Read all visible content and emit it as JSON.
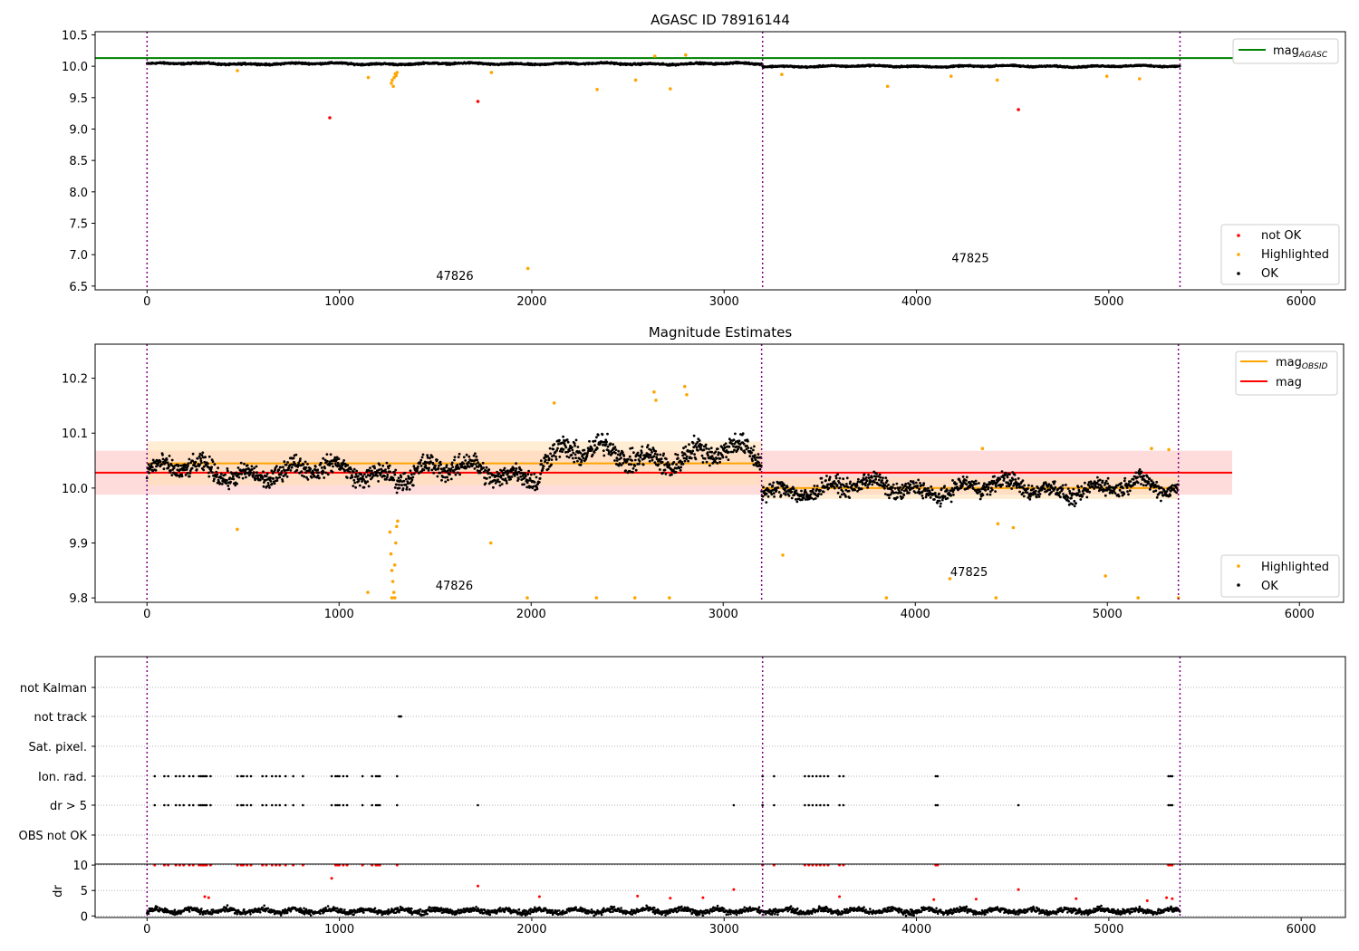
{
  "chart_data": [
    {
      "type": "scatter",
      "title": "AGASC ID 78916144",
      "xlabel": "",
      "ylabel": "",
      "xlim": [
        -270,
        6230
      ],
      "ylim": [
        6.44,
        10.55
      ],
      "x_ticks": [
        0,
        1000,
        2000,
        3000,
        4000,
        5000,
        6000
      ],
      "y_ticks": [
        6.5,
        7.0,
        7.5,
        8.0,
        8.5,
        9.0,
        9.5,
        10.0,
        10.5
      ],
      "obs_boundaries": [
        0,
        3200,
        5370
      ],
      "obs_labels": [
        {
          "text": "47826",
          "x": 1600,
          "y": 6.6
        },
        {
          "text": "47825",
          "x": 4280,
          "y": 6.88
        }
      ],
      "reference_lines": [
        {
          "name": "mag",
          "name_sub": "AGASC",
          "value": 10.13,
          "x_range": [
            -270,
            5650
          ],
          "color": "#008000"
        }
      ],
      "baseline_segments": [
        {
          "x_start": 0,
          "x_end": 3200,
          "level": 10.04,
          "amplitude": 0.035
        },
        {
          "x_start": 3200,
          "x_end": 5370,
          "level": 10.0,
          "amplitude": 0.03
        }
      ],
      "series": [
        {
          "name": "not OK",
          "color": "#ff0000",
          "points": [
            [
              950,
              9.18
            ],
            [
              1720,
              9.44
            ],
            [
              4530,
              9.31
            ]
          ]
        },
        {
          "name": "Highlighted",
          "color": "#ffa500",
          "points": [
            [
              470,
              9.93
            ],
            [
              1150,
              9.82
            ],
            [
              1270,
              9.73
            ],
            [
              1275,
              9.78
            ],
            [
              1280,
              9.68
            ],
            [
              1285,
              9.82
            ],
            [
              1290,
              9.88
            ],
            [
              1295,
              9.85
            ],
            [
              1300,
              9.9
            ],
            [
              1790,
              9.9
            ],
            [
              1980,
              6.78
            ],
            [
              2340,
              9.63
            ],
            [
              2540,
              9.78
            ],
            [
              2720,
              9.64
            ],
            [
              2640,
              10.16
            ],
            [
              2800,
              10.18
            ],
            [
              3300,
              9.87
            ],
            [
              3850,
              9.68
            ],
            [
              4180,
              9.84
            ],
            [
              4420,
              9.78
            ],
            [
              4990,
              9.84
            ],
            [
              5160,
              9.8
            ]
          ]
        },
        {
          "name": "OK",
          "color": "#000000",
          "points": []
        }
      ],
      "legends": [
        {
          "position": "top-right",
          "entries": [
            {
              "name": "mag",
              "sub": "AGASC",
              "kind": "line",
              "color": "#008000"
            }
          ]
        },
        {
          "position": "bottom-right",
          "entries": [
            {
              "name": "not OK",
              "kind": "dot",
              "color": "#ff0000"
            },
            {
              "name": "Highlighted",
              "kind": "dot",
              "color": "#ffa500"
            },
            {
              "name": "OK",
              "kind": "dot",
              "color": "#000000"
            }
          ]
        }
      ]
    },
    {
      "type": "scatter",
      "title": "Magnitude Estimates",
      "xlabel": "",
      "ylabel": "",
      "xlim": [
        -270,
        6230
      ],
      "ylim": [
        9.792,
        10.262
      ],
      "x_ticks": [
        0,
        1000,
        2000,
        3000,
        4000,
        5000,
        6000
      ],
      "y_ticks": [
        9.8,
        9.9,
        10.0,
        10.1,
        10.2
      ],
      "obs_boundaries": [
        0,
        3200,
        5370
      ],
      "obs_labels": [
        {
          "text": "47826",
          "x": 1600,
          "y": 9.815
        },
        {
          "text": "47825",
          "x": 4280,
          "y": 9.84
        }
      ],
      "bands": [
        {
          "name": "mag",
          "center": 10.028,
          "half_width": 0.04,
          "x_range": [
            -270,
            5650
          ],
          "color": "#ffc0c0"
        },
        {
          "name": "mag OBSID 47826",
          "center": 10.045,
          "half_width": 0.04,
          "x_range": [
            0,
            3200
          ],
          "color": "#ffe0b0"
        },
        {
          "name": "mag OBSID 47825",
          "center": 10.0,
          "half_width": 0.02,
          "x_range": [
            3200,
            5370
          ],
          "color": "#ffe0b0"
        }
      ],
      "reference_lines": [
        {
          "name": "mag",
          "value": 10.028,
          "x_range": [
            -270,
            5650
          ],
          "color": "#ff0000"
        },
        {
          "name": "mag",
          "name_sub": "OBSID",
          "value": 10.045,
          "x_range": [
            0,
            3200
          ],
          "color": "#ffa500"
        },
        {
          "name": "mag",
          "name_sub": "OBSID",
          "value": 10.0,
          "x_range": [
            3200,
            5370
          ],
          "color": "#ffa500"
        }
      ],
      "baseline_segments": [
        {
          "x_start": 0,
          "x_end": 1200,
          "level": 10.03,
          "amplitude": 0.045
        },
        {
          "x_start": 1200,
          "x_end": 2050,
          "level": 10.03,
          "amplitude": 0.05
        },
        {
          "x_start": 2050,
          "x_end": 3200,
          "level": 10.06,
          "amplitude": 0.055
        },
        {
          "x_start": 3200,
          "x_end": 5370,
          "level": 10.0,
          "amplitude": 0.04
        }
      ],
      "series": [
        {
          "name": "Highlighted",
          "color": "#ffa500",
          "points": [
            [
              470,
              9.925
            ],
            [
              1150,
              9.81
            ],
            [
              1265,
              9.92
            ],
            [
              1270,
              9.88
            ],
            [
              1275,
              9.85
            ],
            [
              1280,
              9.83
            ],
            [
              1285,
              9.81
            ],
            [
              1290,
              9.86
            ],
            [
              1295,
              9.9
            ],
            [
              1300,
              9.93
            ],
            [
              1305,
              9.94
            ],
            [
              1790,
              9.9
            ],
            [
              2120,
              10.155
            ],
            [
              2640,
              10.175
            ],
            [
              2650,
              10.16
            ],
            [
              2800,
              10.185
            ],
            [
              2810,
              10.17
            ],
            [
              3310,
              9.878
            ],
            [
              4350,
              10.072
            ],
            [
              4430,
              9.935
            ],
            [
              4510,
              9.928
            ],
            [
              4990,
              9.84
            ],
            [
              4180,
              9.835
            ],
            [
              5160,
              9.8
            ],
            [
              5230,
              10.072
            ],
            [
              5320,
              10.07
            ]
          ]
        },
        {
          "name": "Highlighted (clipped)",
          "color": "#ffa500",
          "points": [
            [
              1980,
              9.8
            ],
            [
              2340,
              9.8
            ],
            [
              2540,
              9.8
            ],
            [
              2720,
              9.8
            ],
            [
              3850,
              9.8
            ],
            [
              4420,
              9.8
            ],
            [
              1275,
              9.8
            ],
            [
              1290,
              9.8
            ],
            [
              5370,
              9.8
            ]
          ]
        },
        {
          "name": "OK",
          "color": "#000000",
          "points": []
        }
      ],
      "legends": [
        {
          "position": "top-right",
          "entries": [
            {
              "name": "mag",
              "sub": "OBSID",
              "kind": "line",
              "color": "#ffa500"
            },
            {
              "name": "mag",
              "kind": "line",
              "color": "#ff0000"
            }
          ]
        },
        {
          "position": "bottom-right",
          "entries": [
            {
              "name": "Highlighted",
              "kind": "dot",
              "color": "#ffa500"
            },
            {
              "name": "OK",
              "kind": "dot",
              "color": "#000000"
            }
          ]
        }
      ]
    },
    {
      "type": "scatter",
      "title": "",
      "xlabel": "",
      "ylabel": "",
      "xlim": [
        -270,
        6230
      ],
      "categories": [
        "not Kalman",
        "not track",
        "Sat. pixel.",
        "Ion. rad.",
        "dr > 5",
        "OBS not OK"
      ],
      "obs_boundaries": [
        0,
        3200,
        5370
      ],
      "flag_points": {
        "not track": [
          1310,
          1315,
          1320
        ],
        "Ion. rad.": [
          40,
          90,
          110,
          150,
          170,
          190,
          220,
          240,
          270,
          280,
          290,
          300,
          310,
          330,
          470,
          490,
          500,
          520,
          540,
          600,
          620,
          650,
          670,
          690,
          720,
          760,
          810,
          960,
          980,
          990,
          1000,
          1020,
          1040,
          1120,
          1170,
          1190,
          1200,
          1210,
          1300,
          3200,
          3260,
          3420,
          3440,
          3460,
          3480,
          3500,
          3520,
          3540,
          3600,
          3620,
          4100,
          4110,
          5310,
          5320,
          5330
        ],
        "dr > 5": [
          40,
          90,
          110,
          150,
          170,
          190,
          220,
          240,
          270,
          280,
          290,
          300,
          310,
          330,
          470,
          490,
          500,
          520,
          540,
          600,
          620,
          650,
          670,
          690,
          720,
          760,
          810,
          960,
          980,
          990,
          1000,
          1020,
          1040,
          1120,
          1170,
          1190,
          1200,
          1210,
          1300,
          1720,
          3050,
          3200,
          3260,
          3420,
          3440,
          3460,
          3480,
          3500,
          3520,
          3540,
          3600,
          3620,
          4100,
          4110,
          4530,
          5310,
          5320,
          5330
        ]
      }
    },
    {
      "type": "scatter",
      "title": "",
      "xlabel": "",
      "ylabel": "dr",
      "xlim": [
        -270,
        6230
      ],
      "ylim": [
        -0.3,
        10.2
      ],
      "y_ticks": [
        0,
        5,
        10
      ],
      "x_ticks": [
        0,
        1000,
        2000,
        3000,
        4000,
        5000,
        6000
      ],
      "obs_boundaries": [
        0,
        3200,
        5370
      ],
      "baseline_segments": [
        {
          "x_start": 0,
          "x_end": 5370,
          "level": 1.0,
          "amplitude": 1.3
        }
      ],
      "series": [
        {
          "name": "dr > 5",
          "color": "#ff0000",
          "points": [
            [
              40,
              10
            ],
            [
              90,
              10
            ],
            [
              110,
              10
            ],
            [
              150,
              10
            ],
            [
              170,
              10
            ],
            [
              190,
              10
            ],
            [
              220,
              10
            ],
            [
              240,
              10
            ],
            [
              270,
              10
            ],
            [
              280,
              10
            ],
            [
              290,
              10
            ],
            [
              300,
              10
            ],
            [
              310,
              10
            ],
            [
              330,
              10
            ],
            [
              470,
              10
            ],
            [
              490,
              10
            ],
            [
              500,
              10
            ],
            [
              520,
              10
            ],
            [
              540,
              10
            ],
            [
              600,
              10
            ],
            [
              620,
              10
            ],
            [
              650,
              10
            ],
            [
              670,
              10
            ],
            [
              690,
              10
            ],
            [
              720,
              10
            ],
            [
              760,
              10
            ],
            [
              810,
              10
            ],
            [
              960,
              7.4
            ],
            [
              980,
              10
            ],
            [
              990,
              10
            ],
            [
              1000,
              10
            ],
            [
              1020,
              10
            ],
            [
              1040,
              10
            ],
            [
              1120,
              10
            ],
            [
              1170,
              10
            ],
            [
              1190,
              10
            ],
            [
              1200,
              10
            ],
            [
              1210,
              10
            ],
            [
              1300,
              10
            ],
            [
              1720,
              5.9
            ],
            [
              3050,
              5.2
            ],
            [
              3200,
              10
            ],
            [
              3260,
              10
            ],
            [
              3420,
              10
            ],
            [
              3440,
              10
            ],
            [
              3460,
              10
            ],
            [
              3480,
              10
            ],
            [
              3500,
              10
            ],
            [
              3520,
              10
            ],
            [
              3540,
              10
            ],
            [
              3600,
              10
            ],
            [
              3620,
              10
            ],
            [
              4100,
              10
            ],
            [
              4110,
              10
            ],
            [
              4530,
              5.2
            ],
            [
              5310,
              10
            ],
            [
              5320,
              10
            ],
            [
              5330,
              10
            ]
          ]
        },
        {
          "name": "dr",
          "color": "#ff0000",
          "points": [
            [
              300,
              3.8
            ],
            [
              320,
              3.6
            ],
            [
              2040,
              3.8
            ],
            [
              2550,
              3.9
            ],
            [
              2720,
              3.5
            ],
            [
              2890,
              3.6
            ],
            [
              3600,
              3.8
            ],
            [
              4090,
              3.2
            ],
            [
              4310,
              3.3
            ],
            [
              4830,
              3.4
            ],
            [
              5200,
              3.0
            ],
            [
              5300,
              3.6
            ],
            [
              5330,
              3.4
            ]
          ]
        },
        {
          "name": "OK",
          "color": "#000000",
          "points": []
        }
      ]
    }
  ]
}
